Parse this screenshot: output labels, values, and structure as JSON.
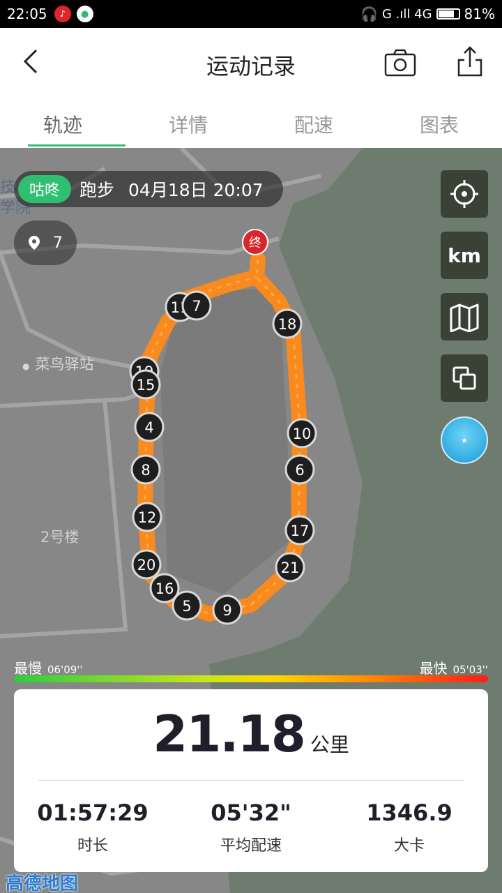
{
  "status_bar": {
    "time": "22:05",
    "network": "G .ıll 4G",
    "battery": "81%",
    "battery_level": 0.81
  },
  "header": {
    "title": "运动记录"
  },
  "tabs": [
    {
      "label": "轨迹",
      "active": true
    },
    {
      "label": "详情",
      "active": false
    },
    {
      "label": "配速",
      "active": false
    },
    {
      "label": "图表",
      "active": false
    }
  ],
  "map": {
    "brand_badge": "咕咚",
    "activity_type": "跑步",
    "activity_date": "04月18日 20:07",
    "photo_count": "7",
    "end_marker": "终",
    "places": {
      "cainiao": "菜鸟驿站",
      "building": "2号楼",
      "institute_line1": "技",
      "institute_line2": "学院"
    },
    "km_markers": [
      "11",
      "7",
      "18",
      "19",
      "15",
      "4",
      "10",
      "8",
      "6",
      "12",
      "17",
      "20",
      "21",
      "16",
      "5",
      "9"
    ],
    "controls": {
      "locate_icon": "locate-icon",
      "unit_label": "km",
      "map_icon": "map-icon",
      "layers_icon": "layers-icon"
    },
    "map_provider": "高德地图"
  },
  "pace_legend": {
    "slow_label": "最慢",
    "slow_value": "06'09''",
    "fast_label": "最快",
    "fast_value": "05'03''"
  },
  "summary": {
    "distance": "21.18",
    "distance_unit": "公里",
    "duration_value": "01:57:29",
    "duration_label": "时长",
    "avg_pace_value": "05'32\"",
    "avg_pace_label": "平均配速",
    "calories_value": "1346.9",
    "calories_label": "大卡"
  }
}
